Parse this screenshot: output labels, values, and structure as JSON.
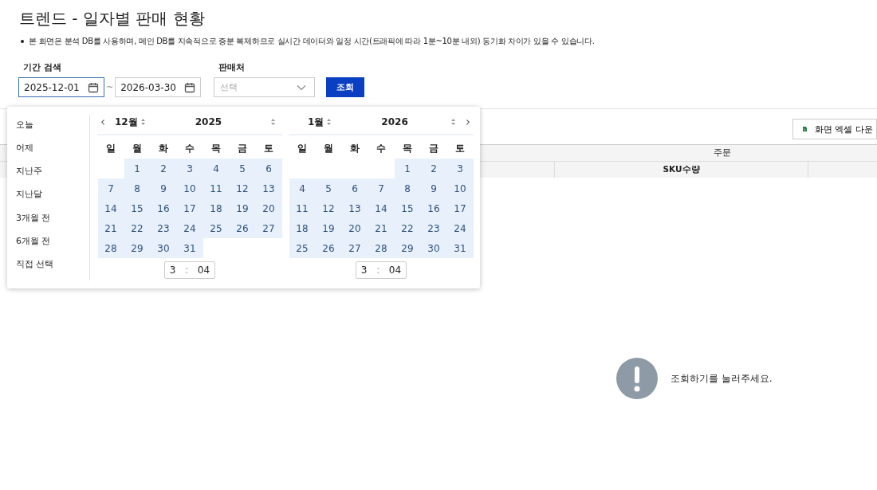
{
  "title": "트렌드 - 일자별 판매 현황",
  "notice": "본 화면은 분석 DB를 사용하며, 메인 DB를 지속적으로 증분 복제하므로 실시간 데이터와 일정 시간(트래픽에 따라 1분~10분 내외) 동기화 차이가 있을 수 있습니다.",
  "filters": {
    "period_label": "기간 검색",
    "start_date": "2025-12-01",
    "separator": "~",
    "end_date": "2026-03-30",
    "seller_label": "판매처",
    "seller_placeholder": "선택",
    "search_button": "조회"
  },
  "date_picker": {
    "presets": [
      {
        "label": "오늘"
      },
      {
        "label": "어제"
      },
      {
        "label": "지난주"
      },
      {
        "label": "지난달"
      },
      {
        "label": "3개월 전"
      },
      {
        "label": "6개월 전"
      },
      {
        "label": "직접 선택"
      }
    ],
    "prev": "‹",
    "next": "›",
    "months": [
      {
        "month": "12월",
        "year": "2025",
        "highlighted": true,
        "hour": "3",
        "time_separator": ":",
        "minute": "04",
        "weekdays": [
          "일",
          "월",
          "화",
          "수",
          "목",
          "금",
          "토"
        ],
        "weeks": [
          [
            "1",
            "2",
            "3",
            "4",
            "5",
            "6"
          ],
          [
            "7",
            "8",
            "9",
            "10",
            "11",
            "12",
            "13"
          ],
          [
            "14",
            "15",
            "16",
            "17",
            "18",
            "19",
            "20"
          ],
          [
            "21",
            "22",
            "23",
            "24",
            "25",
            "26",
            "27"
          ],
          [
            "28",
            "29",
            "30",
            "31"
          ]
        ]
      },
      {
        "month": "1월",
        "year": "2026",
        "highlighted": true,
        "hour": "3",
        "time_separator": ":",
        "minute": "04",
        "weekdays": [
          "일",
          "월",
          "화",
          "수",
          "목",
          "금",
          "토"
        ],
        "weeks": [
          [
            "1",
            "2",
            "3"
          ],
          [
            "4",
            "5",
            "6",
            "7",
            "8",
            "9",
            "10"
          ],
          [
            "11",
            "12",
            "13",
            "14",
            "15",
            "16",
            "17"
          ],
          [
            "18",
            "19",
            "20",
            "21",
            "22",
            "23",
            "24"
          ],
          [
            "25",
            "26",
            "27",
            "28",
            "29",
            "30",
            "31"
          ]
        ]
      }
    ]
  },
  "toolbar": {
    "excel_button": "화면 엑셀 다운"
  },
  "table": {
    "group_header": "주문",
    "columns": [
      "SKU수량"
    ]
  },
  "empty_message": "조회하기를 눌러주세요."
}
